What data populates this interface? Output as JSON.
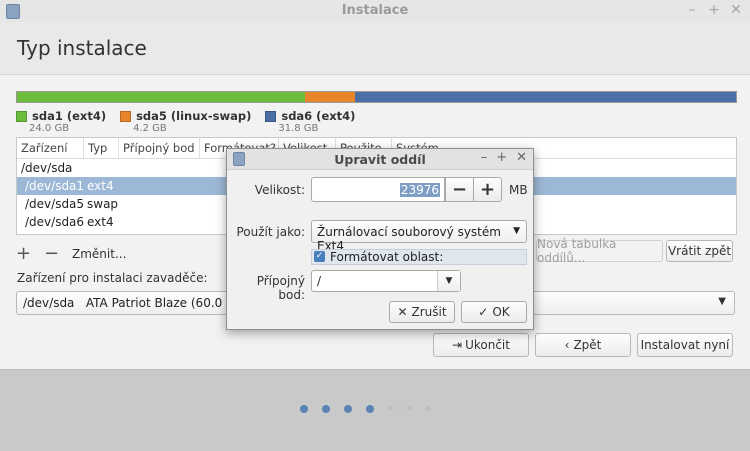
{
  "window": {
    "title": "Instalace"
  },
  "page": {
    "title": "Typ instalace"
  },
  "partition_bar": [
    {
      "name": "sda1",
      "color": "#6cbd3b",
      "share": 0.4
    },
    {
      "name": "sda5",
      "color": "#e8842a",
      "share": 0.07
    },
    {
      "name": "sda6",
      "color": "#4a6fa5",
      "share": 0.53
    }
  ],
  "legend": [
    {
      "label": "sda1 (ext4)",
      "size": "24.0 GB",
      "color": "#6cbd3b"
    },
    {
      "label": "sda5 (linux-swap)",
      "size": "4.2 GB",
      "color": "#e8842a"
    },
    {
      "label": "sda6 (ext4)",
      "size": "31.8 GB",
      "color": "#4a6fa5"
    }
  ],
  "table": {
    "headers": [
      "Zařízení",
      "Typ",
      "Přípojný bod",
      "Formátovat?",
      "Velikost",
      "Použito",
      "Systém"
    ],
    "rows": [
      {
        "device": "/dev/sda",
        "type": ""
      },
      {
        "device": "/dev/sda1",
        "type": "ext4"
      },
      {
        "device": "/dev/sda5",
        "type": "swap"
      },
      {
        "device": "/dev/sda6",
        "type": "ext4"
      }
    ]
  },
  "tools": {
    "add": "+",
    "remove": "−",
    "change": "Změnit..."
  },
  "buttons": {
    "new_table": "Nová tabulka oddílů...",
    "revert": "Vrátit zpět",
    "quit": "Ukončit",
    "back": "Zpět",
    "install": "Instalovat nyní"
  },
  "bootloader": {
    "label": "Zařízení pro instalaci zavaděče:",
    "device": "/dev/sda",
    "model": "ATA Patriot Blaze (60.0 GB)"
  },
  "progress_dots": {
    "total": 7,
    "done": 4
  },
  "dialog": {
    "title": "Upravit oddíl",
    "size_label": "Velikost:",
    "size_value": "23976",
    "unit": "MB",
    "use_as_label": "Použít jako:",
    "use_as_value": "Žurnálovací souborový systém Ext4",
    "format_label": "Formátovat oblast:",
    "format_checked": true,
    "mount_label": "Přípojný bod:",
    "mount_value": "/",
    "cancel": "Zrušit",
    "ok": "OK"
  }
}
